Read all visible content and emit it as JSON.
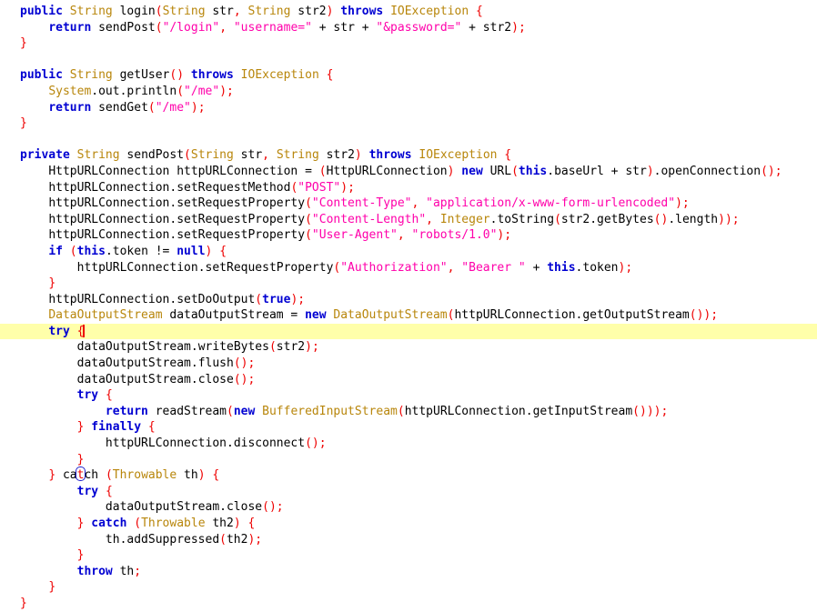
{
  "editor": {
    "language": "java",
    "colors": {
      "background": "#ffffff",
      "foreground": "#000000",
      "keyword": "#0000d2",
      "type": "#b8860b",
      "string": "#ff00aa",
      "punctuation": "#ee0000",
      "current_line_highlight": "#ffffaa",
      "caret": "#ee0000",
      "brace_match_outline": "#2222cc"
    },
    "caret": {
      "line_index": 20,
      "column": 13
    },
    "current_line_index": 20,
    "matching_brace": {
      "line_index": 29,
      "column": 8,
      "char": "}"
    },
    "lines": [
      "public String login(String str, String str2) throws IOException {",
      "    return sendPost(\"/login\", \"username=\" + str + \"&password=\" + str2);",
      "}",
      "",
      "public String getUser() throws IOException {",
      "    System.out.println(\"/me\");",
      "    return sendGet(\"/me\");",
      "}",
      "",
      "private String sendPost(String str, String str2) throws IOException {",
      "    HttpURLConnection httpURLConnection = (HttpURLConnection) new URL(this.baseUrl + str).openConnection();",
      "    httpURLConnection.setRequestMethod(\"POST\");",
      "    httpURLConnection.setRequestProperty(\"Content-Type\", \"application/x-www-form-urlencoded\");",
      "    httpURLConnection.setRequestProperty(\"Content-Length\", Integer.toString(str2.getBytes().length));",
      "    httpURLConnection.setRequestProperty(\"User-Agent\", \"robots/1.0\");",
      "    if (this.token != null) {",
      "        httpURLConnection.setRequestProperty(\"Authorization\", \"Bearer \" + this.token);",
      "    }",
      "    httpURLConnection.setDoOutput(true);",
      "    DataOutputStream dataOutputStream = new DataOutputStream(httpURLConnection.getOutputStream());",
      "    try {",
      "        dataOutputStream.writeBytes(str2);",
      "        dataOutputStream.flush();",
      "        dataOutputStream.close();",
      "        try {",
      "            return readStream(new BufferedInputStream(httpURLConnection.getInputStream()));",
      "        } finally {",
      "            httpURLConnection.disconnect();",
      "        }",
      "    } catch (Throwable th) {",
      "        try {",
      "            dataOutputStream.close();",
      "        } catch (Throwable th2) {",
      "            th.addSuppressed(th2);",
      "        }",
      "        throw th;",
      "    }",
      "}"
    ]
  }
}
